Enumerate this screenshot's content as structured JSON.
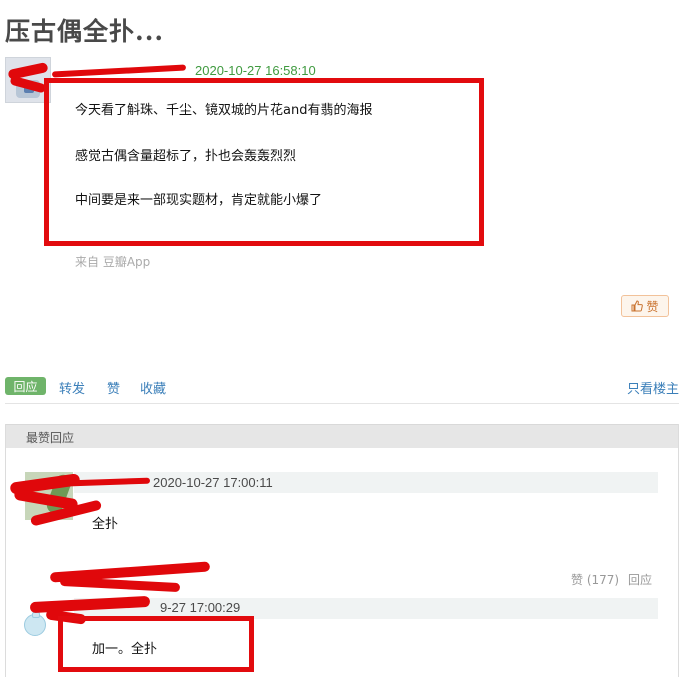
{
  "page": {
    "title": "压古偶全扑..."
  },
  "post": {
    "date": "2020-10-27 16:58:10",
    "lines": [
      "今天看了斛珠、千尘、镜双城的片花and有翡的海报",
      "感觉古偶含量超标了，扑也会轰轰烈烈",
      "中间要是来一部现实题材，肯定就能小爆了"
    ],
    "source": "来自 豆瓣App",
    "like_label": "赞"
  },
  "actions": {
    "reply": "回应",
    "forward": "转发",
    "like": "赞",
    "collect": "收藏",
    "only_op": "只看楼主"
  },
  "section": {
    "title": "最赞回应"
  },
  "replies": [
    {
      "date": "2020-10-27 17:00:11",
      "text": "全扑"
    },
    {
      "likes": "赞 (177)",
      "reply_link": "回应",
      "date_partial": "9-27 17:00:29",
      "text": "加一。全扑"
    }
  ],
  "colors": {
    "accent_green": "#6fb46a",
    "link_blue": "#3b7fb9",
    "redaction_red": "#e20b0e",
    "date_green": "#3f9a3f"
  }
}
